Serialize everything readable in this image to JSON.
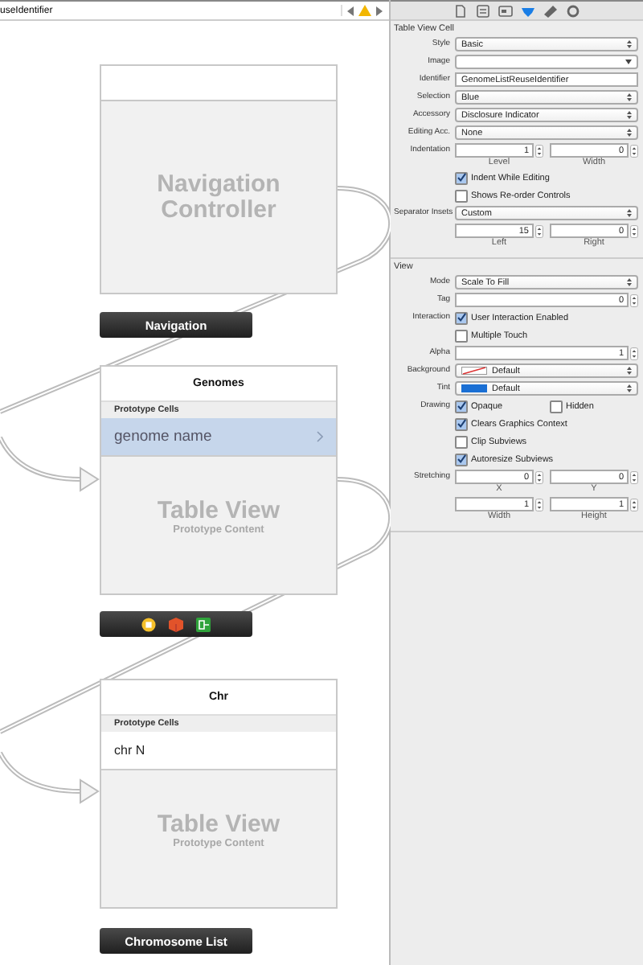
{
  "jump_bar": {
    "path": "useIdentifier"
  },
  "canvas": {
    "scenes": [
      {
        "kind": "navigation",
        "watermark": "Navigation Controller",
        "dock": {
          "kind": "label",
          "text": "Navigation"
        }
      },
      {
        "kind": "table",
        "title": "Genomes",
        "section_header": "Prototype Cells",
        "cell": {
          "text": "genome name",
          "selected": true,
          "disclosure": true
        },
        "watermark": "Table View",
        "subtitle": "Prototype Content",
        "dock": {
          "kind": "icons"
        }
      },
      {
        "kind": "table",
        "title": "Chr",
        "section_header": "Prototype Cells",
        "cell": {
          "text": "chr N",
          "selected": false,
          "disclosure": false
        },
        "watermark": "Table View",
        "subtitle": "Prototype Content",
        "dock": {
          "kind": "label",
          "text": "Chromosome List"
        }
      }
    ]
  },
  "inspector": {
    "tabs": [
      {
        "selected": false
      },
      {
        "selected": false
      },
      {
        "selected": false
      },
      {
        "selected": true
      },
      {
        "selected": false
      },
      {
        "selected": false
      }
    ],
    "sections": [
      {
        "title": "Table View Cell",
        "rows": [
          {
            "kind": "select",
            "label": "Style",
            "value": "Basic"
          },
          {
            "kind": "combo",
            "label": "Image"
          },
          {
            "kind": "text",
            "label": "Identifier",
            "value": "GenomeListReuseIdentifier"
          },
          {
            "kind": "select",
            "label": "Selection",
            "value": "Blue"
          },
          {
            "kind": "select",
            "label": "Accessory",
            "value": "Disclosure Indicator"
          },
          {
            "kind": "select",
            "label": "Editing Acc.",
            "value": "None"
          },
          {
            "kind": "steppers",
            "label": "Indentation",
            "fields": [
              {
                "value": "1",
                "caption": "Level"
              },
              {
                "value": "0",
                "caption": "Width"
              }
            ]
          },
          {
            "kind": "checkbox",
            "text": "Indent While Editing",
            "checked": true
          },
          {
            "kind": "checkbox",
            "text": "Shows Re-order Controls",
            "checked": false
          },
          {
            "kind": "select",
            "label": "Separator Insets",
            "value": "Custom"
          },
          {
            "kind": "steppers",
            "fields": [
              {
                "value": "15",
                "caption": "Left"
              },
              {
                "value": "0",
                "caption": "Right"
              }
            ]
          }
        ]
      },
      {
        "title": "View",
        "rows": [
          {
            "kind": "select",
            "label": "Mode",
            "value": "Scale To Fill"
          },
          {
            "kind": "stepper",
            "label": "Tag",
            "value": "0"
          },
          {
            "kind": "checkbox",
            "label": "Interaction",
            "text": "User Interaction Enabled",
            "checked": true
          },
          {
            "kind": "checkbox",
            "text": "Multiple Touch",
            "checked": false
          },
          {
            "kind": "stepper",
            "label": "Alpha",
            "value": "1"
          },
          {
            "kind": "color",
            "label": "Background",
            "value": "Default"
          },
          {
            "kind": "color",
            "label": "Tint",
            "value": "Default",
            "color": "#1a6fd4"
          },
          {
            "kind": "checkpair",
            "label": "Drawing",
            "items": [
              {
                "text": "Opaque",
                "checked": true
              },
              {
                "text": "Hidden",
                "checked": false
              }
            ]
          },
          {
            "kind": "checkbox",
            "text": "Clears Graphics Context",
            "checked": true
          },
          {
            "kind": "checkbox",
            "text": "Clip Subviews",
            "checked": false
          },
          {
            "kind": "checkbox",
            "text": "Autoresize Subviews",
            "checked": true
          },
          {
            "kind": "steppers",
            "label": "Stretching",
            "fields": [
              {
                "value": "0",
                "caption": "X"
              },
              {
                "value": "0",
                "caption": "Y"
              }
            ]
          },
          {
            "kind": "steppers",
            "fields": [
              {
                "value": "1",
                "caption": "Width"
              },
              {
                "value": "1",
                "caption": "Height"
              }
            ]
          }
        ]
      }
    ]
  }
}
